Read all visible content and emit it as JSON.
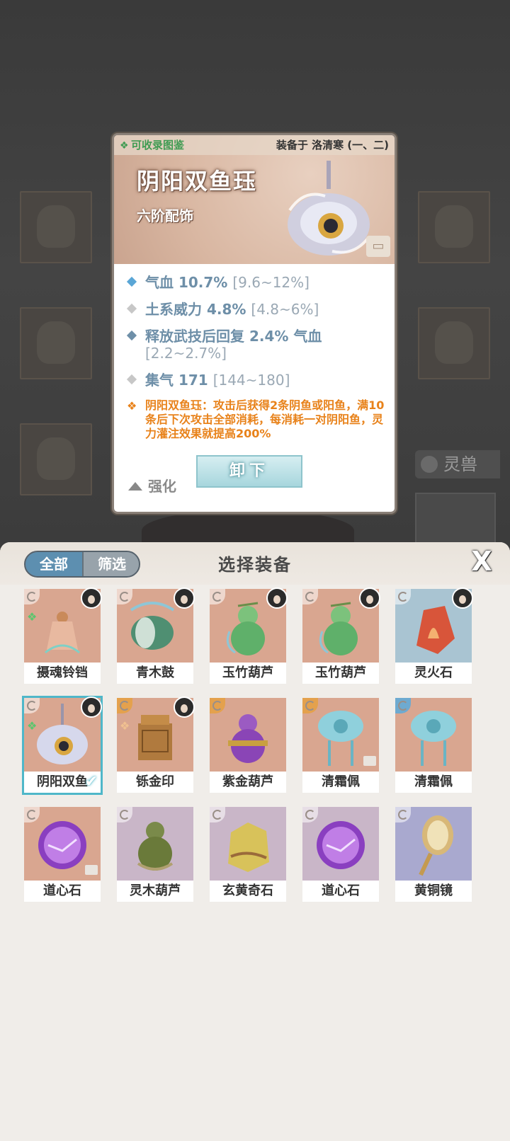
{
  "detail": {
    "collect_label": "可收录图鉴",
    "equipped_label": "装备于 洛清寒 (一、二)",
    "name": "阴阳双鱼珏",
    "grade": "六阶配饰",
    "stats": [
      {
        "label": "气血 10.7%",
        "range": "[9.6~12%]",
        "color": "#5aa6d6"
      },
      {
        "label": "土系威力 4.8%",
        "range": "[4.8~6%]",
        "color": "#c7c7c7"
      },
      {
        "label": "释放武技后回复 2.4% 气血",
        "range": "[2.2~2.7%]",
        "color": "#6e8fa8"
      },
      {
        "label": "集气 171",
        "range": "[144~180]",
        "color": "#c7c7c7"
      }
    ],
    "effect": "阴阳双鱼珏：攻击后获得2条阴鱼或阳鱼，满10条后下次攻击全部消耗，每消耗一对阴阳鱼，灵力灌注效果就提高200%",
    "strengthen_label": "强化",
    "unequip_label": "卸下"
  },
  "background": {
    "beast_tab_label": "灵兽"
  },
  "panel": {
    "tab_all": "全部",
    "tab_filter": "筛选",
    "title": "选择装备",
    "close_label": "X",
    "items": [
      {
        "name": "摄魂铃铛",
        "bg": "#d9a690",
        "avatar": true,
        "mark": "green",
        "corner": "plain",
        "art": "bell"
      },
      {
        "name": "青木鼓",
        "bg": "#d9a690",
        "avatar": true,
        "mark": "",
        "corner": "plain",
        "art": "drum"
      },
      {
        "name": "玉竹葫芦",
        "bg": "#d9a690",
        "avatar": true,
        "mark": "",
        "corner": "plain",
        "art": "gourd-green"
      },
      {
        "name": "玉竹葫芦",
        "bg": "#d9a690",
        "avatar": true,
        "mark": "",
        "corner": "plain",
        "art": "gourd-green"
      },
      {
        "name": "灵火石",
        "bg": "#a9c4d2",
        "avatar": true,
        "mark": "",
        "corner": "plain",
        "art": "fire-stone"
      },
      {
        "name": "阴阳双鱼",
        "bg": "#d9a690",
        "avatar": true,
        "mark": "green",
        "corner": "plain",
        "art": "pendant",
        "selected": true
      },
      {
        "name": "铄金印",
        "bg": "#d9a690",
        "avatar": true,
        "mark": "orange",
        "corner": "gold",
        "art": "seal"
      },
      {
        "name": "紫金葫芦",
        "bg": "#d9a690",
        "avatar": false,
        "mark": "",
        "corner": "gold",
        "art": "gourd-purple"
      },
      {
        "name": "清霜佩",
        "bg": "#d9a690",
        "avatar": false,
        "mark": "",
        "corner": "gold",
        "art": "jade-blue",
        "lock": true
      },
      {
        "name": "清霜佩",
        "bg": "#d9a690",
        "avatar": false,
        "mark": "",
        "corner": "blue",
        "art": "jade-blue"
      },
      {
        "name": "道心石",
        "bg": "#d9a690",
        "avatar": false,
        "mark": "",
        "corner": "plain",
        "art": "orb",
        "lock": true
      },
      {
        "name": "灵木葫芦",
        "bg": "#c9b6c8",
        "avatar": false,
        "mark": "",
        "corner": "plain",
        "art": "gourd-wood"
      },
      {
        "name": "玄黄奇石",
        "bg": "#c9b6c8",
        "avatar": false,
        "mark": "",
        "corner": "plain",
        "art": "rock"
      },
      {
        "name": "道心石",
        "bg": "#c9b6c8",
        "avatar": false,
        "mark": "",
        "corner": "plain",
        "art": "orb"
      },
      {
        "name": "黄铜镜",
        "bg": "#a9a9cf",
        "avatar": false,
        "mark": "",
        "corner": "plain",
        "art": "mirror"
      }
    ]
  }
}
